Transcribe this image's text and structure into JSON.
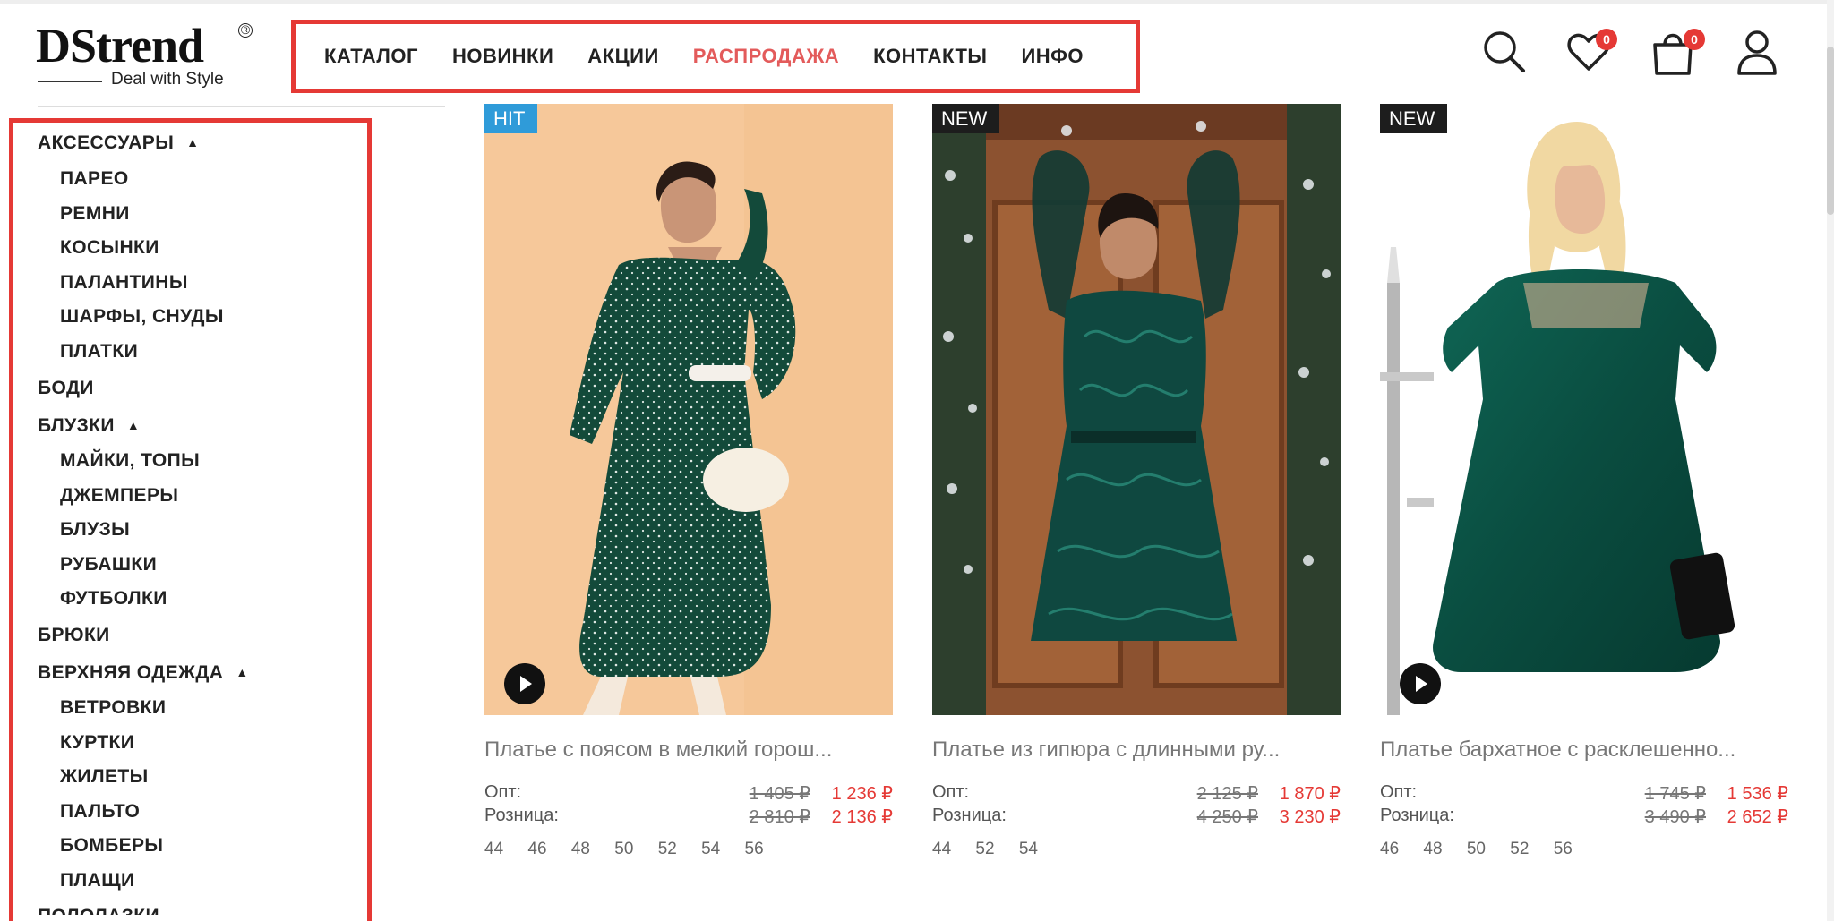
{
  "logo": {
    "brand": "DStrend",
    "reg_mark": "®",
    "tagline": "Deal with Style"
  },
  "nav": [
    "КАТАЛОГ",
    "НОВИНКИ",
    "АКЦИИ",
    "РАСПРОДАЖА",
    "КОНТАКТЫ",
    "ИНФО"
  ],
  "header_icons": {
    "favorites_count": "0",
    "cart_count": "0"
  },
  "sidebar": {
    "accessories": {
      "label": "АКСЕССУАРЫ",
      "items": [
        "ПАРЕО",
        "РЕМНИ",
        "КОСЫНКИ",
        "ПАЛАНТИНЫ",
        "ШАРФЫ, СНУДЫ",
        "ПЛАТКИ"
      ]
    },
    "bodysuits": "БОДИ",
    "blouses": {
      "label": "БЛУЗКИ",
      "items": [
        "МАЙКИ, ТОПЫ",
        "ДЖЕМПЕРЫ",
        "БЛУЗЫ",
        "РУБАШКИ",
        "ФУТБОЛКИ"
      ]
    },
    "trousers": "БРЮКИ",
    "outerwear": {
      "label": "ВЕРХНЯЯ ОДЕЖДА",
      "items": [
        "ВЕТРОВКИ",
        "КУРТКИ",
        "ЖИЛЕТЫ",
        "ПАЛЬТО",
        "БОМБЕРЫ",
        "ПЛАЩИ"
      ]
    },
    "cut_item": "ПОЛОЛАЗКИ",
    "caret": "▲"
  },
  "products": [
    {
      "tag": "HIT",
      "name": "Платье с поясом в мелкий горош...",
      "opt_label": "Опт:",
      "retail_label": "Розница:",
      "opt_old": "1 405 ₽",
      "opt_new": "1 236 ₽",
      "retail_old": "2 810 ₽",
      "retail_new": "2 136 ₽",
      "sizes": [
        "44",
        "46",
        "48",
        "50",
        "52",
        "54",
        "56"
      ]
    },
    {
      "tag": "NEW",
      "name": "Платье из гипюра с длинными ру...",
      "opt_label": "Опт:",
      "retail_label": "Розница:",
      "opt_old": "2 125 ₽",
      "opt_new": "1 870 ₽",
      "retail_old": "4 250 ₽",
      "retail_new": "3 230 ₽",
      "sizes": [
        "44",
        "52",
        "54"
      ]
    },
    {
      "tag": "NEW",
      "name": "Платье бархатное с расклешенно...",
      "opt_label": "Опт:",
      "retail_label": "Розница:",
      "opt_old": "1 745 ₽",
      "opt_new": "1 536 ₽",
      "retail_old": "3 490 ₽",
      "retail_new": "2 652 ₽",
      "sizes": [
        "46",
        "48",
        "50",
        "52",
        "56"
      ]
    }
  ],
  "colors": {
    "accent_red": "#e53935",
    "sale_nav": "#e35b5b",
    "hit_tag": "#2f9bd9",
    "new_tag": "#1d1d1d",
    "dress_green": "#134a3a"
  }
}
